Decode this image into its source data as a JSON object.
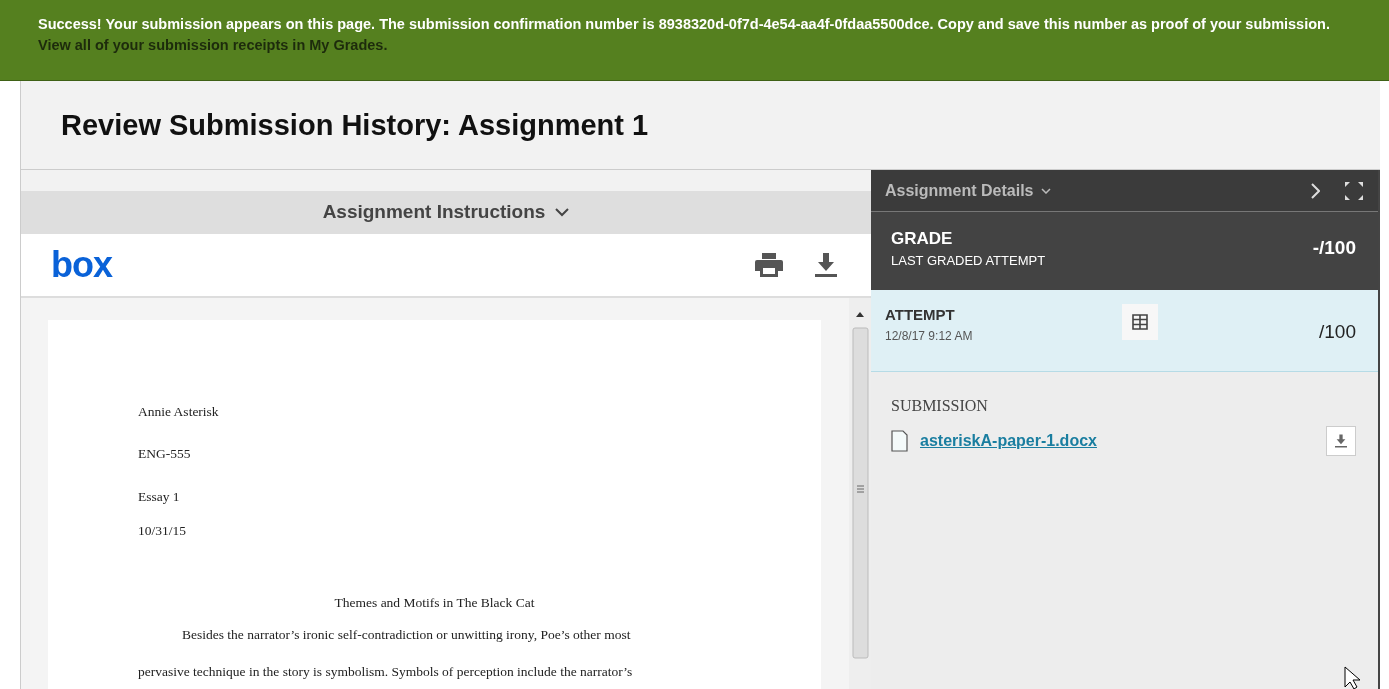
{
  "banner": {
    "message": "**Success!** Your submission appears on this page. The submission confirmation number is 8938320d-0f7d-4e54-aa4f-0fdaa5500dce. Copy and save this number as proof of your submission.",
    "link": "View all of your submission receipts in My Grades."
  },
  "page_title": "Review Submission History: Assignment 1",
  "instructions": {
    "title": "Assignment Instructions",
    "expanded": false
  },
  "viewer": {
    "logo": "box",
    "document": {
      "header_lines": [
        "Annie Asterisk",
        "ENG-555",
        "Essay 1",
        "10/31/15"
      ],
      "heading": "Themes and Motifs in The Black Cat",
      "body_lines": [
        "Besides the narrator’s ironic self-contradiction or unwitting irony, Poe’s other most",
        "pervasive technique in the story is symbolism. Symbols of perception include the narrator’s"
      ]
    }
  },
  "details": {
    "title": "Assignment Details",
    "grade": {
      "label": "GRADE",
      "sublabel": "LAST GRADED ATTEMPT",
      "value": "-/100"
    },
    "attempt": {
      "label": "ATTEMPT",
      "date": "12/8/17 9:12 AM",
      "value": "/100",
      "selected": true
    },
    "submission": {
      "label": "SUBMISSION",
      "file": "asteriskA-paper-1.docx"
    }
  }
}
